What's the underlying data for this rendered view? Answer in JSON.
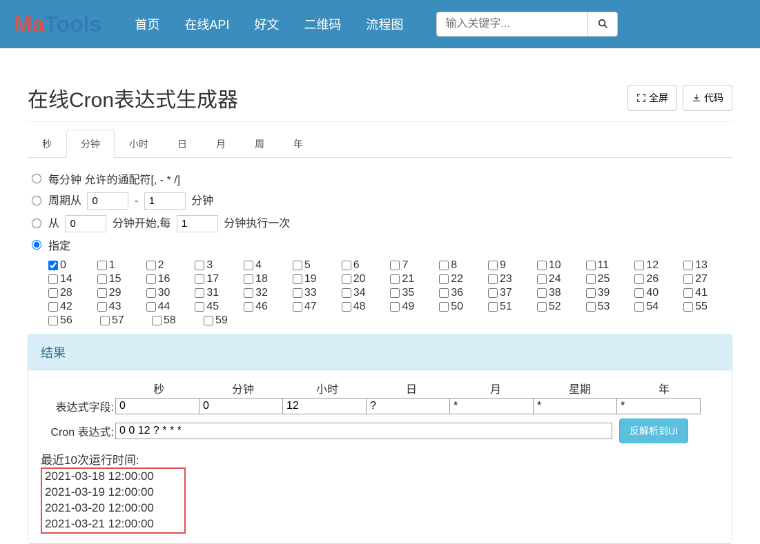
{
  "logo": {
    "ma": "Ma",
    "tools": "Tools"
  },
  "nav": {
    "home": "首页",
    "api": "在线API",
    "articles": "好文",
    "qrcode": "二维码",
    "flowchart": "流程图"
  },
  "search": {
    "placeholder": "输入关键字..."
  },
  "page": {
    "title": "在线Cron表达式生成器",
    "fullscreen": "全屏",
    "code": "代码"
  },
  "tabs": {
    "second": "秒",
    "minute": "分钟",
    "hour": "小时",
    "day": "日",
    "month": "月",
    "week": "周",
    "year": "年"
  },
  "options": {
    "wildcard": "每分钟 允许的通配符[, - * /]",
    "period_from": "周期从",
    "period_p0": "0",
    "period_dash": "-",
    "period_p1": "1",
    "period_suffix": "分钟",
    "start_from": "从",
    "start_v0": "0",
    "start_mid": "分钟开始,每",
    "start_v1": "1",
    "start_suffix": "分钟执行一次",
    "specify": "指定"
  },
  "minute_grid": {
    "checked": [
      0
    ],
    "rows": [
      [
        0,
        1,
        2,
        3,
        4,
        5,
        6,
        7,
        8,
        9,
        10,
        11,
        12,
        13
      ],
      [
        14,
        15,
        16,
        17,
        18,
        19,
        20,
        21,
        22,
        23,
        24,
        25,
        26,
        27
      ],
      [
        28,
        29,
        30,
        31,
        32,
        33,
        34,
        35,
        36,
        37,
        38,
        39,
        40,
        41
      ],
      [
        42,
        43,
        44,
        45,
        46,
        47,
        48,
        49,
        50,
        51,
        52,
        53,
        54,
        55
      ],
      [
        56,
        57,
        58,
        59
      ]
    ]
  },
  "result": {
    "header": "结果",
    "field_labels": {
      "second": "秒",
      "minute": "分钟",
      "hour": "小时",
      "day": "日",
      "month": "月",
      "week": "星期",
      "year": "年"
    },
    "expr_field_label": "表达式字段:",
    "fields": {
      "second": "0",
      "minute": "0",
      "hour": "12",
      "day": "?",
      "month": "*",
      "week": "*",
      "year": "*"
    },
    "cron_label": "Cron 表达式:",
    "cron_value": "0 0 12 ? * * *",
    "parse_btn": "反解析到UI",
    "runtimes_label": "最近10次运行时间:",
    "runtimes": [
      "2021-03-18 12:00:00",
      "2021-03-19 12:00:00",
      "2021-03-20 12:00:00",
      "2021-03-21 12:00:00"
    ]
  }
}
